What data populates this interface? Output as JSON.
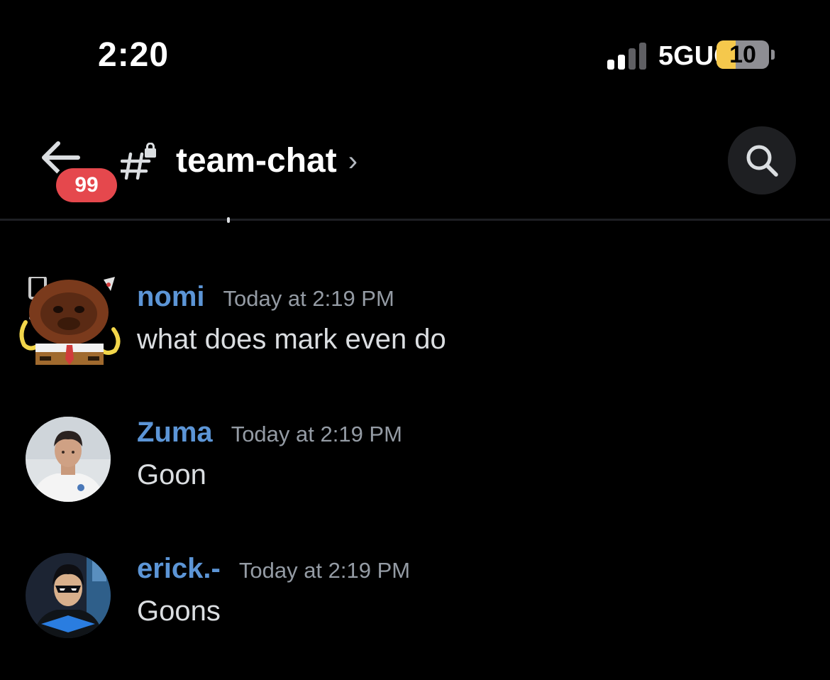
{
  "status_bar": {
    "time": "2:20",
    "network": "5GUC",
    "battery_level": "10",
    "battery_fraction": 0.1,
    "signal_bars_active": 2,
    "signal_bars_total": 4
  },
  "header": {
    "back_icon": "back-arrow-icon",
    "unread_count": "99",
    "channel_icon": "locked-hashtag-icon",
    "channel_name": "team-chat",
    "chevron": "›",
    "search_icon": "search-icon"
  },
  "messages": [
    {
      "author": "nomi",
      "timestamp": "Today at 2:19 PM",
      "text": "what does mark even do",
      "author_color": "#5c95d6"
    },
    {
      "author": "Zuma",
      "timestamp": "Today at 2:19 PM",
      "text": "Goon",
      "author_color": "#5c95d6"
    },
    {
      "author": "erick.-",
      "timestamp": "Today at 2:19 PM",
      "text": "Goons",
      "author_color": "#5c95d6"
    }
  ],
  "colors": {
    "background": "#000000",
    "badge": "#e5484d",
    "author_name": "#5c95d6",
    "timestamp": "#949ba4",
    "message_text": "#dbdee1",
    "battery_fill": "#f5c84c"
  }
}
